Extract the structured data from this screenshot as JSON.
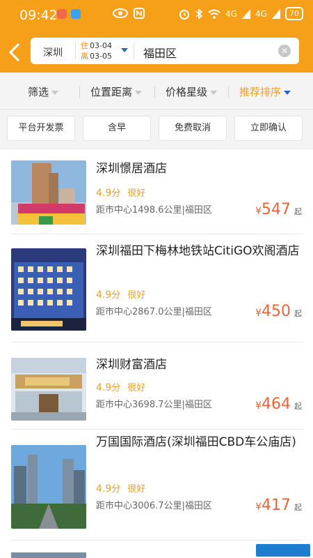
{
  "status": {
    "time": "09:42",
    "battery": "70",
    "signal1": "4G",
    "signal2": "4G"
  },
  "search": {
    "city": "深圳",
    "checkin_key": "住",
    "checkin": "03-04",
    "checkout_key": "离",
    "checkout": "03-05",
    "query": "福田区"
  },
  "filters": [
    {
      "label": "筛选"
    },
    {
      "label": "位置距离"
    },
    {
      "label": "价格星级"
    },
    {
      "label": "推荐排序"
    }
  ],
  "tags": [
    "平台开发票",
    "含早",
    "免费取消",
    "立即确认"
  ],
  "hotels": [
    {
      "name": "深圳憬居酒店",
      "score": "4.9",
      "score_unit": "分",
      "rating": "很好",
      "distance": "距市中心1498.6公里|福田区",
      "currency": "¥",
      "price": "547",
      "qi": "起"
    },
    {
      "name": "深圳福田下梅林地铁站CitiGO欢阁酒店",
      "score": "4.9",
      "score_unit": "分",
      "rating": "很好",
      "distance": "距市中心2867.0公里|福田区",
      "currency": "¥",
      "price": "450",
      "qi": "起"
    },
    {
      "name": "深圳财富酒店",
      "score": "4.9",
      "score_unit": "分",
      "rating": "很好",
      "distance": "距市中心3698.7公里|福田区",
      "currency": "¥",
      "price": "464",
      "qi": "起"
    },
    {
      "name": "万国国际酒店(深圳福田CBD车公庙店)",
      "score": "4.9",
      "score_unit": "分",
      "rating": "很好",
      "distance": "距市中心3006.7公里|福田区",
      "currency": "¥",
      "price": "417",
      "qi": "起"
    }
  ],
  "colors": {
    "brand": "#f6a01a",
    "price": "#e6663c",
    "accent": "#e8a02a",
    "caret_active": "#2a62c9"
  }
}
